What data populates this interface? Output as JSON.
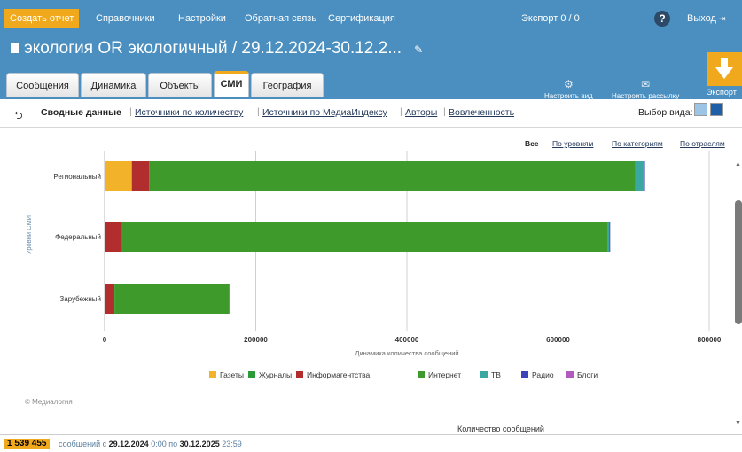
{
  "topnav": {
    "create_report": "Создать отчет",
    "items": [
      "Справочники",
      "Настройки",
      "Обратная связь",
      "Сертификация"
    ],
    "export_count": "Экспорт 0 / 0",
    "help": "?",
    "logout": "Выход"
  },
  "report": {
    "title": "экология OR экологичный / 29.12.2024-30.12.2..."
  },
  "tabs": [
    "Сообщения",
    "Динамика",
    "Объекты",
    "СМИ",
    "География"
  ],
  "active_tab": "СМИ",
  "toolbar": {
    "configure_view": "Настроить вид",
    "configure_mailing": "Настроить рассылку",
    "export": "Экспорт"
  },
  "subnav": {
    "current": "Сводные данные",
    "links": [
      "Источники по количеству",
      "Источники по МедиаИндексу",
      "Авторы",
      "Вовлеченность"
    ],
    "view_select_label": "Выбор вида:"
  },
  "filters": {
    "active": "Все",
    "links": [
      "По уровням",
      "По категориям",
      "По отраслям"
    ]
  },
  "chart_data": {
    "type": "bar",
    "orientation": "horizontal",
    "stacked": true,
    "categories": [
      "Региональный",
      "Федеральный",
      "Зарубежный"
    ],
    "xlabel": "Динамика количества сообщений",
    "ylabel": "Уровни СМИ",
    "xlim": [
      0,
      800000
    ],
    "xticks": [
      "0",
      "200000",
      "400000",
      "600000",
      "800000"
    ],
    "xtick_values": [
      0,
      200000,
      400000,
      600000,
      800000
    ],
    "grid": true,
    "legend_position": "bottom",
    "series": [
      {
        "name": "Газеты",
        "color": "#f2b22a",
        "values": [
          36000,
          0,
          0
        ]
      },
      {
        "name": "Журналы",
        "color": "#2d9a3a",
        "values": [
          0,
          0,
          0
        ]
      },
      {
        "name": "Информагентства",
        "color": "#b22d2d",
        "values": [
          23000,
          23000,
          13000
        ]
      },
      {
        "name": "Интернет",
        "color": "#3e9a2a",
        "values": [
          643000,
          643000,
          152000
        ]
      },
      {
        "name": "ТВ",
        "color": "#3aa8a0",
        "values": [
          11000,
          2000,
          1000
        ]
      },
      {
        "name": "Радио",
        "color": "#3b44b8",
        "values": [
          2000,
          1000,
          0
        ]
      },
      {
        "name": "Блоги",
        "color": "#b15bbf",
        "values": [
          0,
          0,
          0
        ]
      }
    ]
  },
  "copyright": "© Медиалогия",
  "section_title": "Количество сообщений",
  "status": {
    "count": "1 539 455",
    "messages_word": "сообщений",
    "from_word": "с",
    "from_date": "29.12.2024",
    "from_time": "0:00",
    "to_word": "по",
    "to_date": "30.12.2025",
    "to_time": "23:59"
  }
}
